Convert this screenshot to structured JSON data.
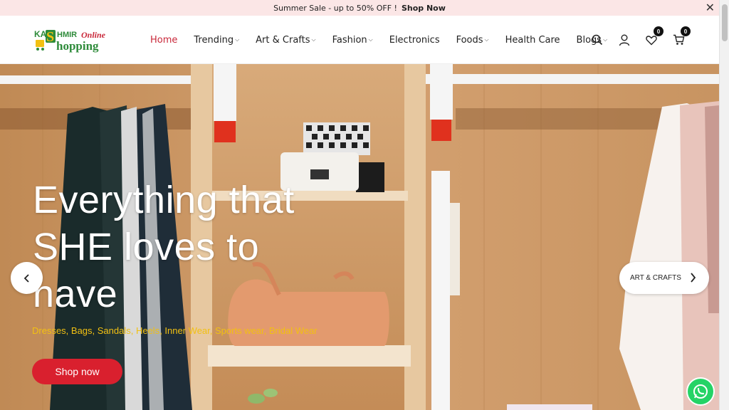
{
  "announcement": {
    "text": "Summer Sale - up to 50% OFF !",
    "link": "Shop Now",
    "close_icon": "close-icon"
  },
  "logo": {
    "part1": "KA",
    "part2": "HMIR",
    "part3": "Online",
    "part4": "hopping"
  },
  "nav": {
    "items": [
      {
        "label": "Home",
        "active": true,
        "dropdown": false
      },
      {
        "label": "Trending",
        "active": false,
        "dropdown": true
      },
      {
        "label": "Art & Crafts",
        "active": false,
        "dropdown": true
      },
      {
        "label": "Fashion",
        "active": false,
        "dropdown": true
      },
      {
        "label": "Electronics",
        "active": false,
        "dropdown": false
      },
      {
        "label": "Foods",
        "active": false,
        "dropdown": true
      },
      {
        "label": "Health Care",
        "active": false,
        "dropdown": false
      },
      {
        "label": "Blogs",
        "active": false,
        "dropdown": true
      }
    ]
  },
  "header_icons": {
    "search": "search-icon",
    "account": "user-icon",
    "wishlist": "heart-icon",
    "wishlist_count": "0",
    "cart": "cart-icon",
    "cart_count": "0"
  },
  "hero": {
    "heading_line1": "Everything that",
    "heading_line2": "SHE loves to",
    "heading_line3": "have",
    "subtitle": "Dresses, Bags, Sandals, Heels, Inner Wear, Sports wear, Bridal Wear",
    "button_label": "Shop now",
    "next_slide_label": "ART & CRAFTS"
  },
  "colors": {
    "accent_red": "#d9202e",
    "active_nav": "#c9283a",
    "subtitle_yellow": "#f2c012",
    "topbar_bg": "#fbe6e6",
    "logo_green": "#2e8b3a"
  }
}
